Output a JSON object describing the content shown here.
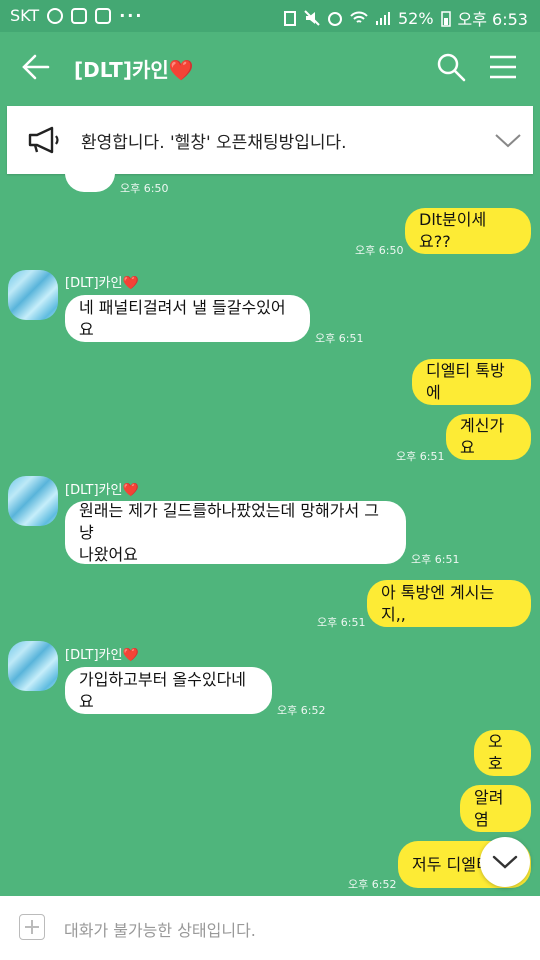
{
  "status_bar": {
    "carrier": "SKT",
    "battery": "52%",
    "clock": "오후 6:53",
    "dots": "···"
  },
  "header": {
    "title_prefix": "[DLT]카인",
    "title_heart": "❤️"
  },
  "notice": {
    "text": "환영합니다. '헬창' 오픈채팅방입니다."
  },
  "messages": [
    {
      "dir": "in",
      "text": "",
      "time": "오후 6:50"
    },
    {
      "dir": "out",
      "text": "Dlt분이세요??",
      "time": "오후 6:50"
    },
    {
      "dir": "in",
      "sender": "[DLT]카인",
      "heart": "❤️",
      "text": "네 패널티걸려서 낼 들갈수있어요",
      "time": "오후 6:51"
    },
    {
      "dir": "out",
      "text": "디엘티 톡방에",
      "time": ""
    },
    {
      "dir": "out",
      "text": "계신가요",
      "time": "오후 6:51"
    },
    {
      "dir": "in",
      "sender": "[DLT]카인",
      "heart": "❤️",
      "text_line1": "원래는 제가 길드를하나팠었는데 망해가서 그냥",
      "text_line2": "나왔어요",
      "time": "오후 6:51"
    },
    {
      "dir": "out",
      "text": "아 톡방엔 계시는지,,",
      "time": "오후 6:51"
    },
    {
      "dir": "in",
      "sender": "[DLT]카인",
      "heart": "❤️",
      "text": "가입하고부터 올수있다네요",
      "time": "오후 6:52"
    },
    {
      "dir": "out",
      "text": "오호",
      "time": ""
    },
    {
      "dir": "out",
      "text": "알려염",
      "time": ""
    },
    {
      "dir": "out",
      "text": "저두 디엘티",
      "time": "오후 6:52"
    }
  ],
  "input": {
    "placeholder": "대화가 불가능한 상태입니다."
  },
  "colors": {
    "background": "#4FB57C",
    "outgoing_bubble": "#FDEB35",
    "incoming_bubble": "#FFFFFF"
  }
}
